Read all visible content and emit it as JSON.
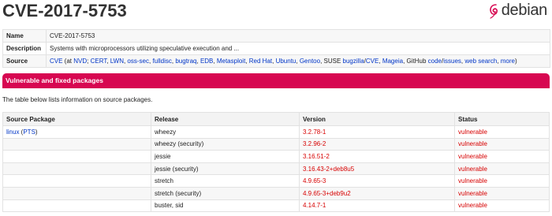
{
  "title": "CVE-2017-5753",
  "logo": {
    "text": "debian",
    "icon": "debian-swirl-icon"
  },
  "info": {
    "name_key": "Name",
    "name_val": "CVE-2017-5753",
    "desc_key": "Description",
    "desc_val": "Systems with microprocessors utilizing speculative execution and ...",
    "source_key": "Source",
    "source_parts": [
      {
        "t": "CVE",
        "link": true
      },
      {
        "t": " (at ",
        "link": false
      },
      {
        "t": "NVD",
        "link": true
      },
      {
        "t": "; ",
        "link": false
      },
      {
        "t": "CERT",
        "link": true
      },
      {
        "t": ", ",
        "link": false
      },
      {
        "t": "LWN",
        "link": true
      },
      {
        "t": ", ",
        "link": false
      },
      {
        "t": "oss-sec",
        "link": true
      },
      {
        "t": ", ",
        "link": false
      },
      {
        "t": "fulldisc",
        "link": true
      },
      {
        "t": ", ",
        "link": false
      },
      {
        "t": "bugtraq",
        "link": true
      },
      {
        "t": ", ",
        "link": false
      },
      {
        "t": "EDB",
        "link": true
      },
      {
        "t": ", ",
        "link": false
      },
      {
        "t": "Metasploit",
        "link": true
      },
      {
        "t": ", ",
        "link": false
      },
      {
        "t": "Red Hat",
        "link": true
      },
      {
        "t": ", ",
        "link": false
      },
      {
        "t": "Ubuntu",
        "link": true
      },
      {
        "t": ", ",
        "link": false
      },
      {
        "t": "Gentoo",
        "link": true
      },
      {
        "t": ", SUSE ",
        "link": false
      },
      {
        "t": "bugzilla",
        "link": true
      },
      {
        "t": "/",
        "link": false
      },
      {
        "t": "CVE",
        "link": true
      },
      {
        "t": ", ",
        "link": false
      },
      {
        "t": "Mageia",
        "link": true
      },
      {
        "t": ", GitHub ",
        "link": false
      },
      {
        "t": "code",
        "link": true
      },
      {
        "t": "/",
        "link": false
      },
      {
        "t": "issues",
        "link": true
      },
      {
        "t": ", ",
        "link": false
      },
      {
        "t": "web search",
        "link": true
      },
      {
        "t": ", ",
        "link": false
      },
      {
        "t": "more",
        "link": true
      },
      {
        "t": ")",
        "link": false
      }
    ]
  },
  "section_title": "Vulnerable and fixed packages",
  "note": "The table below lists information on source packages.",
  "pkg_headers": [
    "Source Package",
    "Release",
    "Version",
    "Status"
  ],
  "pkg_source": {
    "name": "linux",
    "open": " (",
    "pts": "PTS",
    "close": ")"
  },
  "pkg_rows": [
    {
      "release": "wheezy",
      "version": "3.2.78-1",
      "status": "vulnerable"
    },
    {
      "release": "wheezy (security)",
      "version": "3.2.96-2",
      "status": "vulnerable"
    },
    {
      "release": "jessie",
      "version": "3.16.51-2",
      "status": "vulnerable"
    },
    {
      "release": "jessie (security)",
      "version": "3.16.43-2+deb8u5",
      "status": "vulnerable"
    },
    {
      "release": "stretch",
      "version": "4.9.65-3",
      "status": "vulnerable"
    },
    {
      "release": "stretch (security)",
      "version": "4.9.65-3+deb9u2",
      "status": "vulnerable"
    },
    {
      "release": "buster, sid",
      "version": "4.14.7-1",
      "status": "vulnerable"
    }
  ],
  "colors": {
    "accent": "#d70751",
    "link": "#0035c7",
    "vulnerable": "#d70000"
  }
}
